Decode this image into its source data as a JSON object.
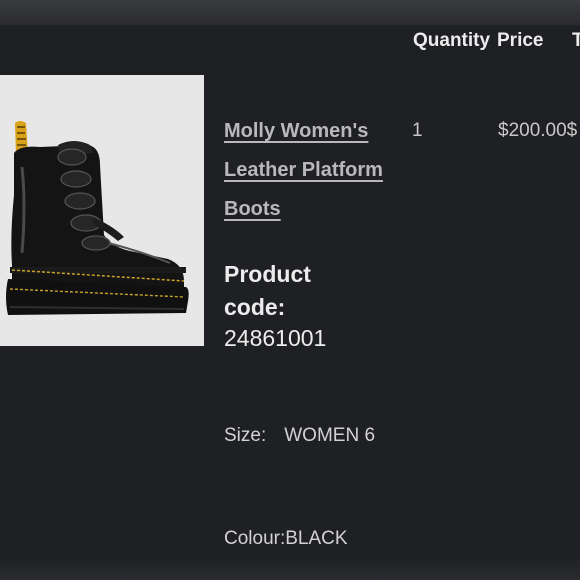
{
  "table": {
    "headers": {
      "quantity": "Quantity",
      "price": "Price",
      "total": "T"
    }
  },
  "item": {
    "title": "Molly Women's Leather Platform Boots",
    "quantity": "1",
    "price": "$200.00$",
    "product_code_label": "Product code:",
    "product_code": "24861001",
    "size_label": "Size:",
    "size_value": "WOMEN 6",
    "colour_label": "Colour:",
    "colour_value": "BLACK",
    "image_icon": "boot-image"
  },
  "colors": {
    "background": "#1f2023",
    "link": "#b9b9bd",
    "text": "#ececec",
    "image_bg": "#e6e6e6"
  }
}
